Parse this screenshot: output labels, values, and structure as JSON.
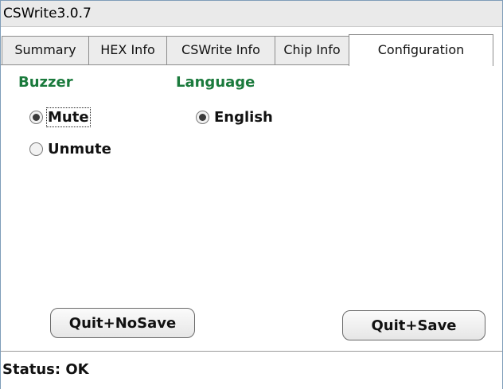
{
  "window": {
    "title": "CSWrite3.0.7"
  },
  "tabs": [
    {
      "label": "Summary"
    },
    {
      "label": "HEX Info"
    },
    {
      "label": "CSWrite Info"
    },
    {
      "label": "Chip Info"
    },
    {
      "label": "Configuration",
      "active": true
    }
  ],
  "buzzer": {
    "label": "Buzzer",
    "options": [
      {
        "label": "Mute",
        "checked": true
      },
      {
        "label": "Unmute",
        "checked": false
      }
    ]
  },
  "language": {
    "label": "Language",
    "options": [
      {
        "label": "English",
        "checked": true
      }
    ]
  },
  "buttons": {
    "quit_nosave": "Quit+NoSave",
    "quit_save": "Quit+Save"
  },
  "status": {
    "text": "Status:  OK"
  },
  "colors": {
    "group_label": "#1a7a3c",
    "window_border": "#7f9db9"
  }
}
